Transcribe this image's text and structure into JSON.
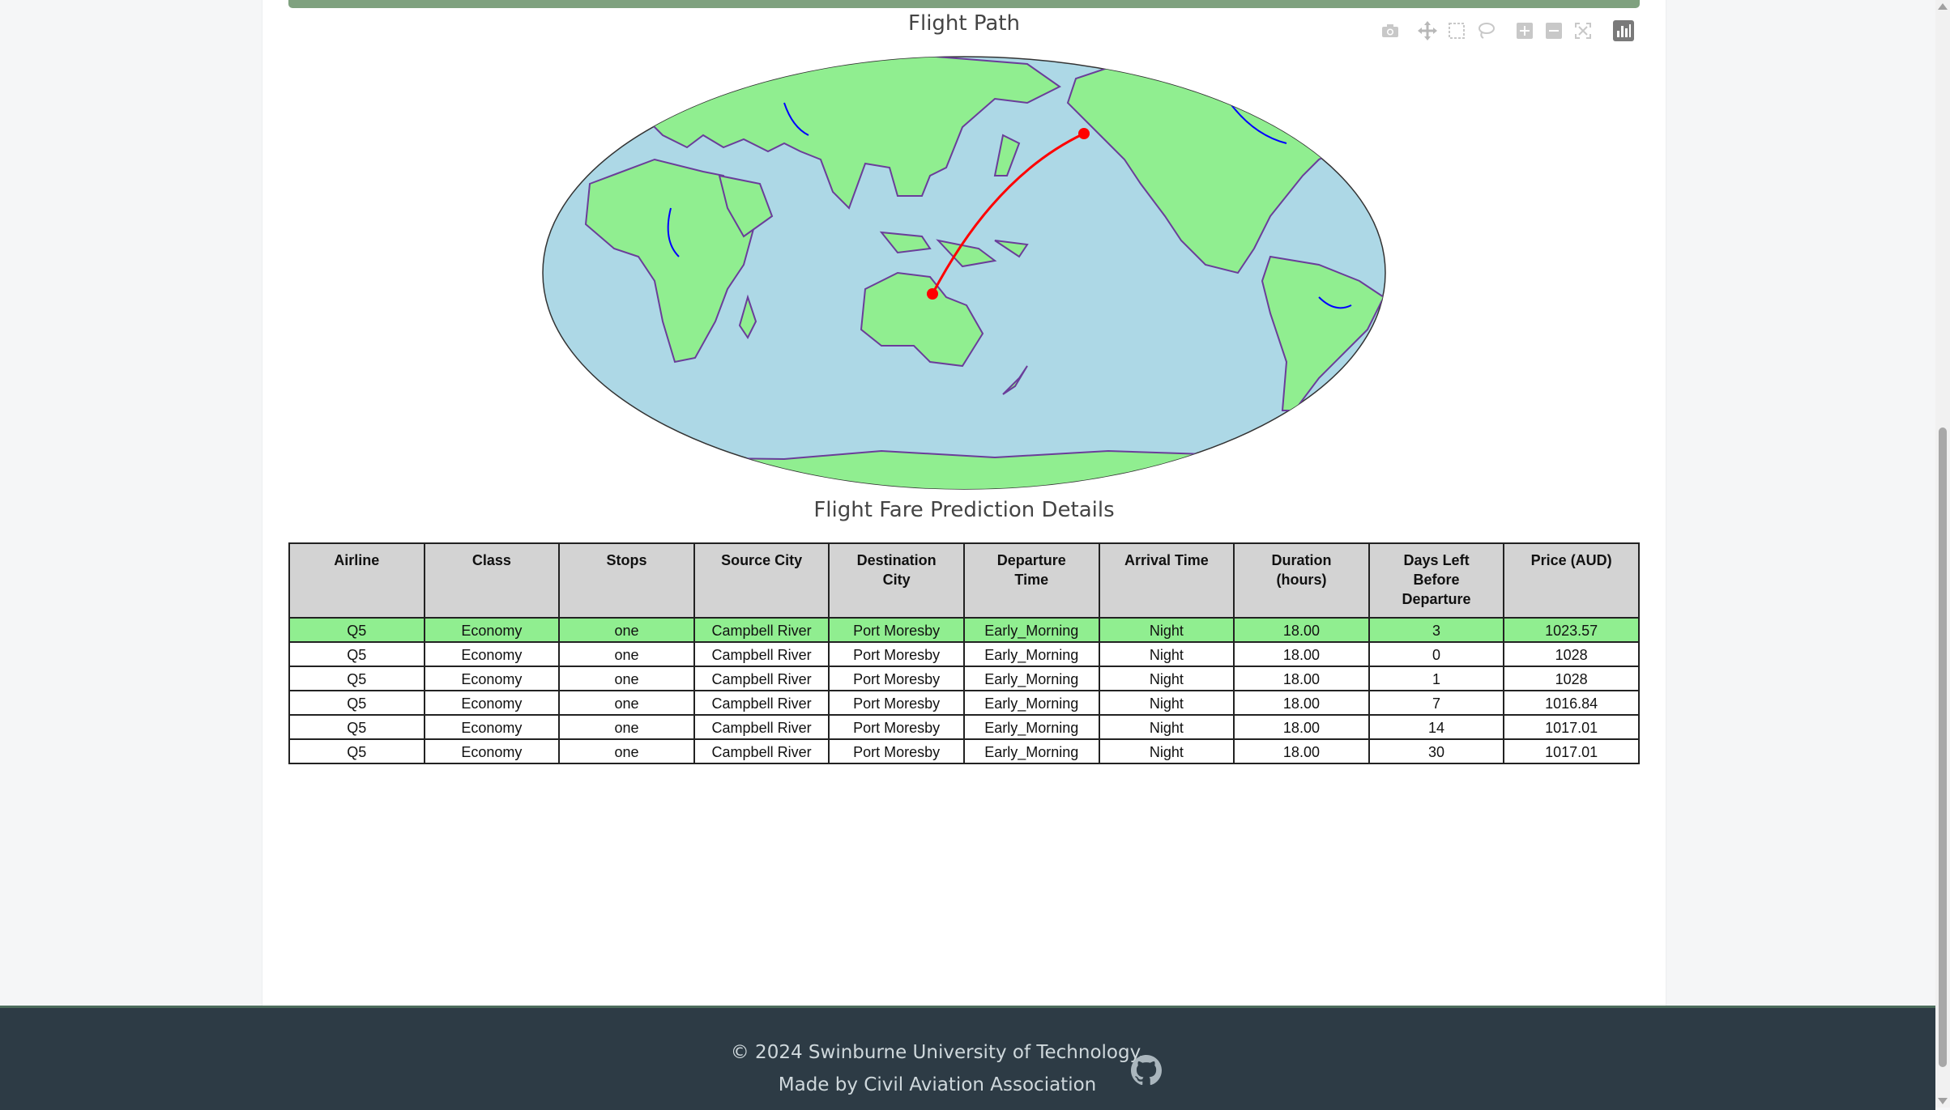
{
  "map": {
    "title": "Flight Path",
    "colors": {
      "land": "#90ee90",
      "ocean": "#add8e6",
      "borders": "#6a3d9a",
      "rivers": "#0000ff",
      "route": "#ff0000"
    },
    "modebar": [
      "camera-icon",
      "pan-icon",
      "box-select-icon",
      "lasso-icon",
      "zoom-in-icon",
      "zoom-out-icon",
      "reset-icon",
      "plotly-logo-icon"
    ]
  },
  "table": {
    "title": "Flight Fare Prediction Details",
    "headers": [
      "Airline",
      "Class",
      "Stops",
      "Source City",
      "Destination City",
      "Departure Time",
      "Arrival Time",
      "Duration (hours)",
      "Days Left Before Departure",
      "Price (AUD)"
    ],
    "rows": [
      [
        "Q5",
        "Economy",
        "one",
        "Campbell River",
        "Port Moresby",
        "Early_Morning",
        "Night",
        "18.00",
        "3",
        "1023.57"
      ],
      [
        "Q5",
        "Economy",
        "one",
        "Campbell River",
        "Port Moresby",
        "Early_Morning",
        "Night",
        "18.00",
        "0",
        "1028"
      ],
      [
        "Q5",
        "Economy",
        "one",
        "Campbell River",
        "Port Moresby",
        "Early_Morning",
        "Night",
        "18.00",
        "1",
        "1028"
      ],
      [
        "Q5",
        "Economy",
        "one",
        "Campbell River",
        "Port Moresby",
        "Early_Morning",
        "Night",
        "18.00",
        "7",
        "1016.84"
      ],
      [
        "Q5",
        "Economy",
        "one",
        "Campbell River",
        "Port Moresby",
        "Early_Morning",
        "Night",
        "18.00",
        "14",
        "1017.01"
      ],
      [
        "Q5",
        "Economy",
        "one",
        "Campbell River",
        "Port Moresby",
        "Early_Morning",
        "Night",
        "18.00",
        "30",
        "1017.01"
      ]
    ],
    "highlight_color": "#90ee90"
  },
  "footer": {
    "copyright": "© 2024 Swinburne University of Technology.",
    "made_by": "Made by Civil Aviation Association",
    "icon": "github-icon"
  }
}
